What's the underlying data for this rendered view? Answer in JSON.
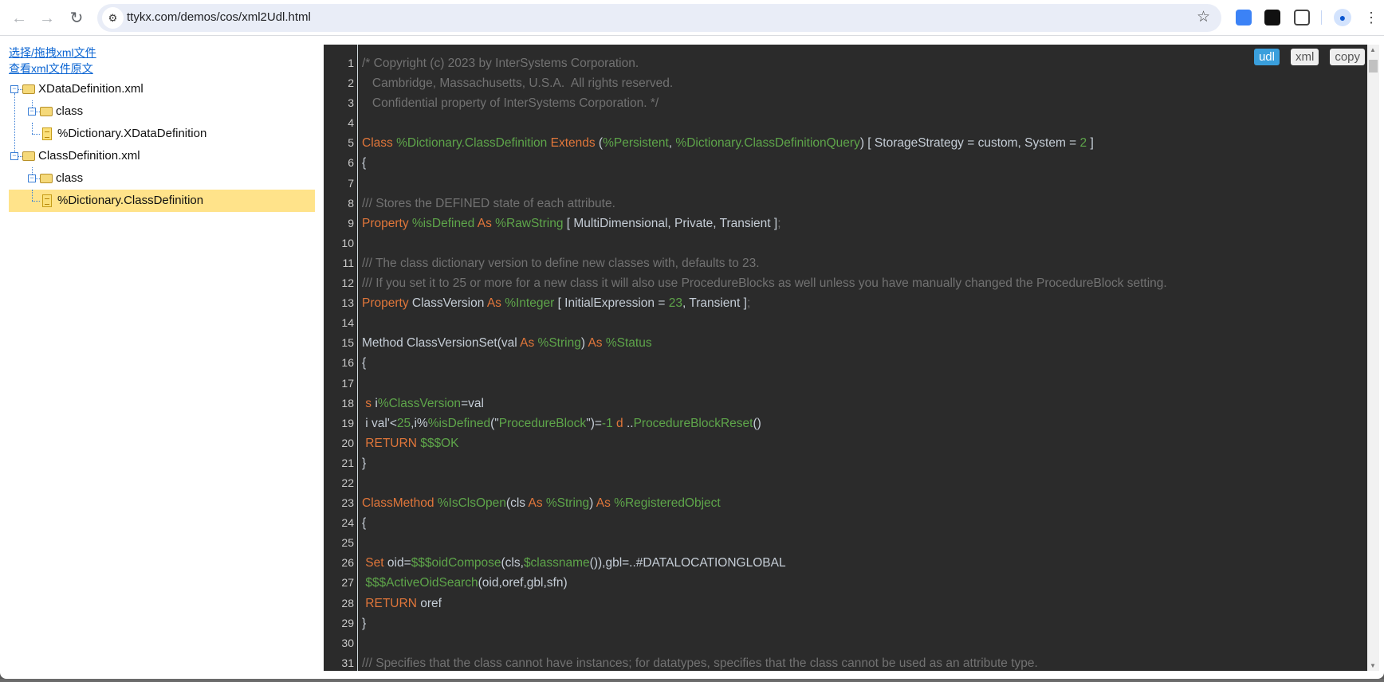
{
  "browser": {
    "url": "ttykx.com/demos/cos/xml2Udl.html",
    "icons": [
      "back-icon",
      "forward-icon",
      "reload-icon",
      "site-settings-icon",
      "bookmark-star-icon",
      "extension-icon",
      "profile-icon",
      "menu-icon"
    ]
  },
  "links": {
    "choose": "选择/拖拽xml文件",
    "view": "查看xml文件原文"
  },
  "tree": [
    {
      "label": "XDataDefinition.xml",
      "level": 0,
      "type": "folder"
    },
    {
      "label": "class",
      "level": 1,
      "type": "folder"
    },
    {
      "label": "%Dictionary.XDataDefinition",
      "level": 2,
      "type": "file"
    },
    {
      "label": "ClassDefinition.xml",
      "level": 0,
      "type": "folder"
    },
    {
      "label": "class",
      "level": 1,
      "type": "folder"
    },
    {
      "label": "%Dictionary.ClassDefinition",
      "level": 2,
      "type": "file",
      "selected": true
    }
  ],
  "editor": {
    "buttons": {
      "udl": "udl",
      "xml": "xml",
      "copy": "copy"
    },
    "active_button": "udl",
    "colors": {
      "background": "#2b2b2b",
      "keyword": "#e0763a",
      "type": "#5ea54a",
      "comment": "#727272",
      "accent": "#3a9fdc"
    },
    "lines": [
      [
        [
          "c",
          "/* Copyright (c) 2023 by InterSystems Corporation."
        ]
      ],
      [
        [
          "c",
          "   Cambridge, Massachusetts, U.S.A.  All rights reserved."
        ]
      ],
      [
        [
          "c",
          "   Confidential property of InterSystems Corporation. */"
        ]
      ],
      [],
      [
        [
          "k",
          "Class"
        ],
        [
          "t",
          " %Dictionary.ClassDefinition"
        ],
        [
          "k",
          " Extends"
        ],
        [
          "p",
          " ("
        ],
        [
          "t",
          "%Persistent"
        ],
        [
          "p",
          ", "
        ],
        [
          "t",
          "%Dictionary.ClassDefinitionQuery"
        ],
        [
          "p",
          ") [ StorageStrategy = custom, System = "
        ],
        [
          "n",
          "2"
        ],
        [
          "p",
          " ]"
        ]
      ],
      [
        [
          "p",
          "{"
        ]
      ],
      [],
      [
        [
          "c",
          "/// Stores the DEFINED state of each attribute."
        ]
      ],
      [
        [
          "k",
          "Property"
        ],
        [
          "t",
          " %isDefined"
        ],
        [
          "k",
          " As"
        ],
        [
          "t",
          " %RawString"
        ],
        [
          "p",
          " [ MultiDimensional, Private, Transient ]"
        ],
        [
          "c",
          ";"
        ]
      ],
      [],
      [
        [
          "c",
          "/// The class dictionary version to define new classes with, defaults to 23."
        ]
      ],
      [
        [
          "c",
          "/// If you set it to 25 or more for a new class it will also use ProcedureBlocks as well unless you have manually changed the ProcedureBlock setting."
        ]
      ],
      [
        [
          "k",
          "Property"
        ],
        [
          "p",
          " ClassVersion "
        ],
        [
          "k",
          "As"
        ],
        [
          "t",
          " %Integer"
        ],
        [
          "p",
          " [ InitialExpression = "
        ],
        [
          "n",
          "23"
        ],
        [
          "p",
          ", Transient ]"
        ],
        [
          "c",
          ";"
        ]
      ],
      [],
      [
        [
          "p",
          "Method ClassVersionSet(val "
        ],
        [
          "k",
          "As"
        ],
        [
          "t",
          " %String"
        ],
        [
          "p",
          ") "
        ],
        [
          "k",
          "As"
        ],
        [
          "t",
          " %Status"
        ]
      ],
      [
        [
          "p",
          "{"
        ]
      ],
      [],
      [
        [
          "k",
          " s"
        ],
        [
          "p",
          " i"
        ],
        [
          "t",
          "%ClassVersion"
        ],
        [
          "p",
          "=val"
        ]
      ],
      [
        [
          "p",
          " i val'<"
        ],
        [
          "n",
          "25"
        ],
        [
          "p",
          ",i%"
        ],
        [
          "t",
          "%isDefined"
        ],
        [
          "p",
          "(\""
        ],
        [
          "t",
          "ProcedureBlock"
        ],
        [
          "p",
          "\")="
        ],
        [
          "n",
          "-1"
        ],
        [
          "k",
          " d"
        ],
        [
          "p",
          " .."
        ],
        [
          "t",
          "ProcedureBlockReset"
        ],
        [
          "p",
          "()"
        ]
      ],
      [
        [
          "k",
          " RETURN"
        ],
        [
          "t",
          " $$$OK"
        ]
      ],
      [
        [
          "p",
          "}"
        ]
      ],
      [],
      [
        [
          "k",
          "ClassMethod"
        ],
        [
          "t",
          " %IsClsOpen"
        ],
        [
          "p",
          "(cls "
        ],
        [
          "k",
          "As"
        ],
        [
          "t",
          " %String"
        ],
        [
          "p",
          ") "
        ],
        [
          "k",
          "As"
        ],
        [
          "t",
          " %RegisteredObject"
        ]
      ],
      [
        [
          "p",
          "{"
        ]
      ],
      [],
      [
        [
          "k",
          " Set"
        ],
        [
          "p",
          " oid="
        ],
        [
          "t",
          "$$$oidCompose"
        ],
        [
          "p",
          "(cls,"
        ],
        [
          "t",
          "$classname"
        ],
        [
          "p",
          "()),gbl=..#DATALOCATIONGLOBAL"
        ]
      ],
      [
        [
          "p",
          " "
        ],
        [
          "t",
          "$$$ActiveOidSearch"
        ],
        [
          "p",
          "(oid,oref,gbl,sfn)"
        ]
      ],
      [
        [
          "k",
          " RETURN"
        ],
        [
          "p",
          " oref"
        ]
      ],
      [
        [
          "p",
          "}"
        ]
      ],
      [],
      [
        [
          "c",
          "/// Specifies that the class cannot have instances; for datatypes, specifies that the class cannot be used as an attribute type."
        ]
      ]
    ]
  }
}
